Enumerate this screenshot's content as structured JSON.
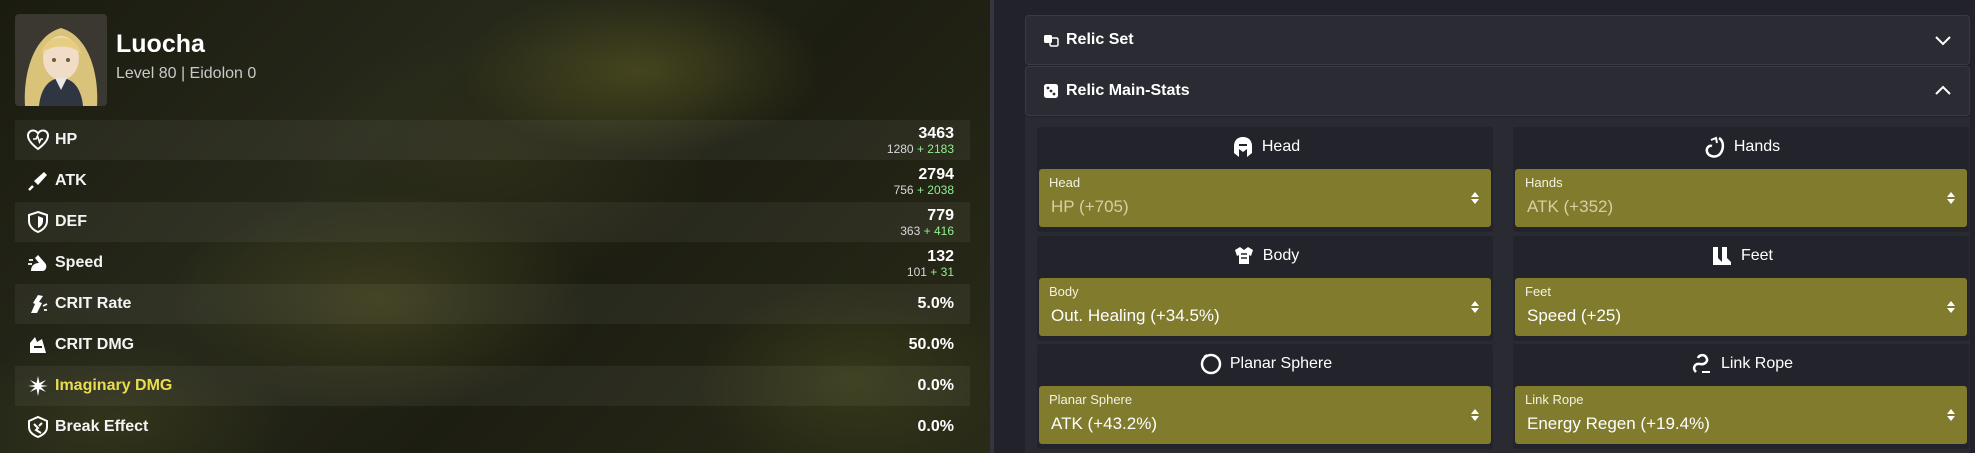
{
  "character": {
    "name": "Luocha",
    "subtitle": "Level 80 | Eidolon 0"
  },
  "stats": [
    {
      "label": "HP",
      "icon": "hp-icon",
      "total": "3463",
      "base": "1280",
      "bonus": "+ 2183"
    },
    {
      "label": "ATK",
      "icon": "atk-icon",
      "total": "2794",
      "base": "756",
      "bonus": "+ 2038"
    },
    {
      "label": "DEF",
      "icon": "def-icon",
      "total": "779",
      "base": "363",
      "bonus": "+ 416"
    },
    {
      "label": "Speed",
      "icon": "speed-icon",
      "total": "132",
      "base": "101",
      "bonus": "+ 31"
    },
    {
      "label": "CRIT Rate",
      "icon": "crit-rate-icon",
      "value": "5.0%"
    },
    {
      "label": "CRIT DMG",
      "icon": "crit-dmg-icon",
      "value": "50.0%"
    },
    {
      "label": "Imaginary DMG",
      "icon": "imaginary-icon",
      "value": "0.0%",
      "color": "#e8dd4f"
    },
    {
      "label": "Break Effect",
      "icon": "break-effect-icon",
      "value": "0.0%"
    }
  ],
  "relic_set": {
    "title": "Relic Set",
    "icon": "relic-set-icon",
    "state": "collapsed"
  },
  "relic_main_stats": {
    "title": "Relic Main-Stats",
    "icon": "dice-icon",
    "state": "expanded",
    "slots": [
      {
        "title": "Head",
        "icon": "head-icon",
        "field_label": "Head",
        "value": "HP (+705)",
        "locked": true
      },
      {
        "title": "Hands",
        "icon": "hands-icon",
        "field_label": "Hands",
        "value": "ATK (+352)",
        "locked": true
      },
      {
        "title": "Body",
        "icon": "body-icon",
        "field_label": "Body",
        "value": "Out. Healing (+34.5%)",
        "locked": false
      },
      {
        "title": "Feet",
        "icon": "feet-icon",
        "field_label": "Feet",
        "value": "Speed (+25)",
        "locked": false
      },
      {
        "title": "Planar Sphere",
        "icon": "planar-sphere-icon",
        "field_label": "Planar Sphere",
        "value": "ATK (+43.2%)",
        "locked": false
      },
      {
        "title": "Link Rope",
        "icon": "link-rope-icon",
        "field_label": "Link Rope",
        "value": "Energy Regen (+19.4%)",
        "locked": false
      }
    ]
  },
  "colors": {
    "select_bg": "#807b2d",
    "panel_bg": "#22232a",
    "bonus_green": "#8ff08f",
    "imaginary_yellow": "#e8dd4f"
  }
}
